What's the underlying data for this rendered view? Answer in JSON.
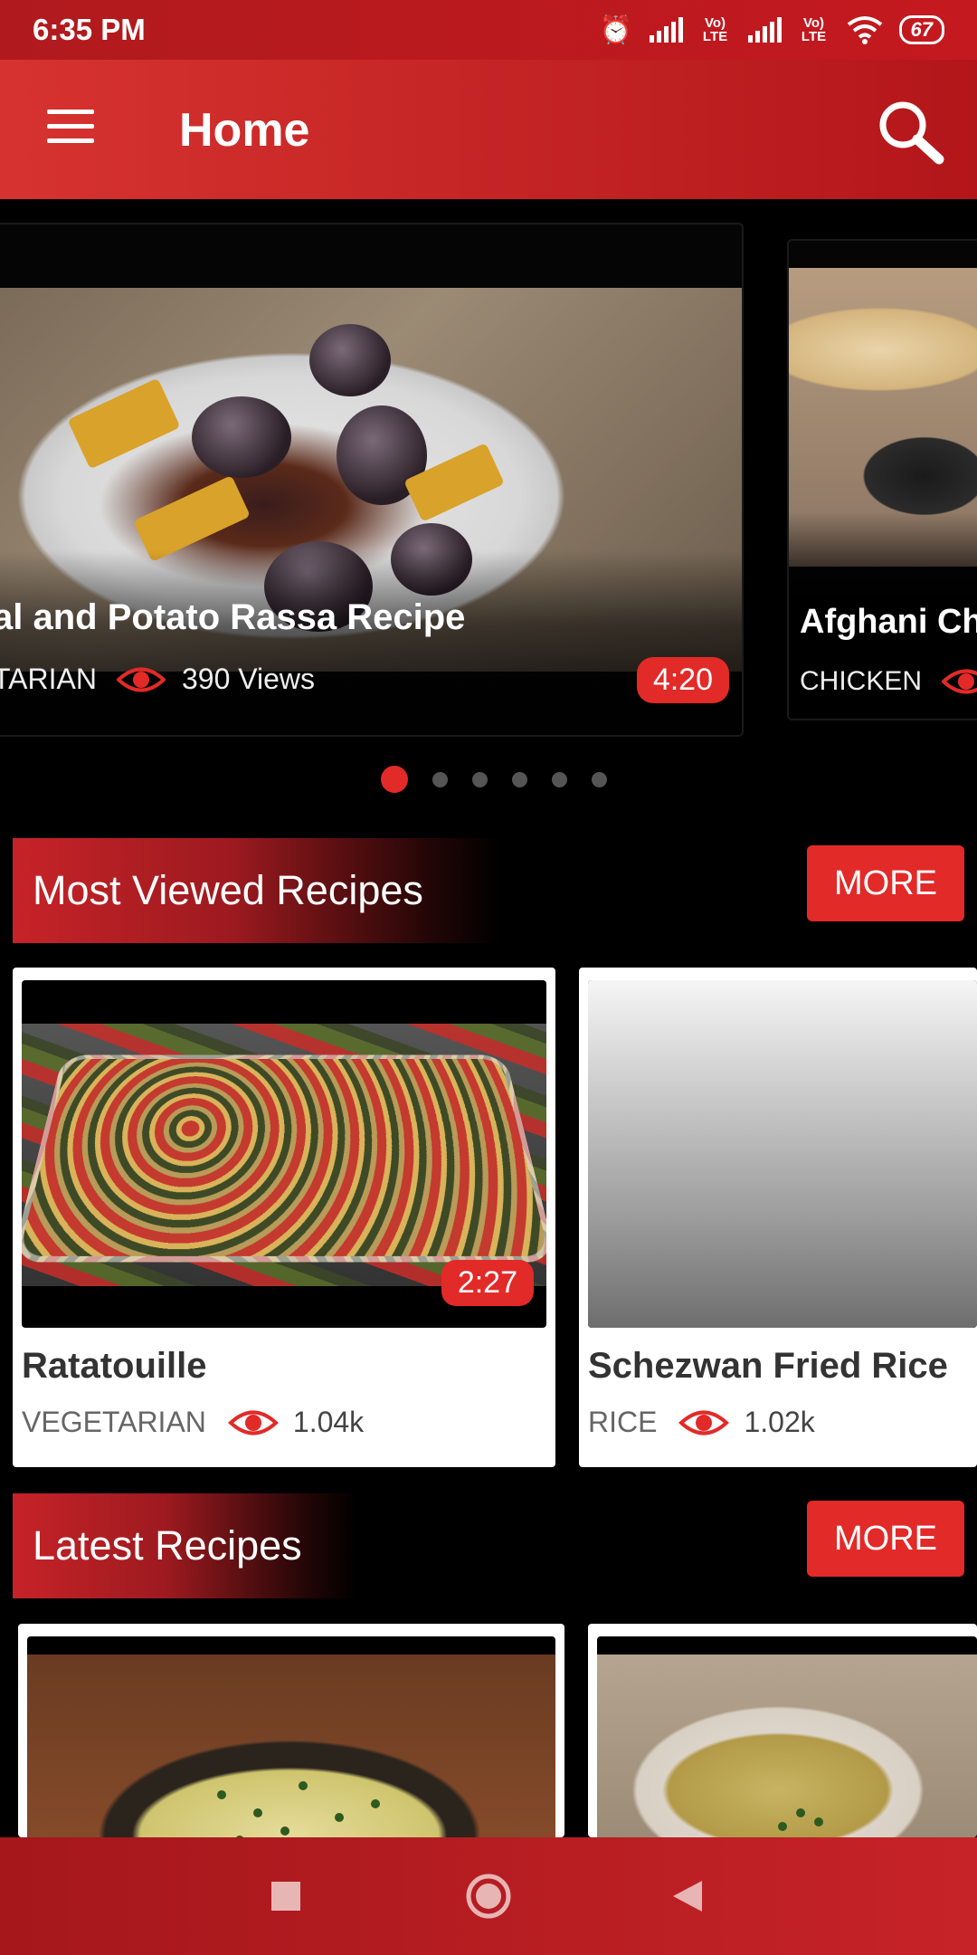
{
  "status_bar": {
    "time": "6:35 PM",
    "network_1": "Vo) LTE",
    "network_2": "Vo) LTE",
    "battery": "67"
  },
  "app_bar": {
    "title": "Home",
    "menu_icon": "hamburger-menu-icon",
    "search_icon": "search-icon"
  },
  "carousel": {
    "main": {
      "title": "al and Potato Rassa Recipe",
      "category": "TARIAN",
      "views": "390 Views",
      "duration": "4:20"
    },
    "peek": {
      "title": "Afghani Ch",
      "category": "CHICKEN"
    },
    "dots_count": 6,
    "active_dot": 0
  },
  "most_viewed": {
    "title": "Most Viewed Recipes",
    "more_label": "MORE",
    "cards": [
      {
        "title": "Ratatouille",
        "category": "VEGETARIAN",
        "views": "1.04k",
        "duration": "2:27"
      },
      {
        "title": "Schezwan Fried Rice",
        "category": "RICE",
        "views": "1.02k"
      }
    ]
  },
  "latest": {
    "title": "Latest Recipes",
    "more_label": "MORE"
  },
  "colors": {
    "accent": "#e22a28",
    "app_bar_start": "#d63330",
    "app_bar_end": "#b3161a",
    "background": "#000000"
  }
}
